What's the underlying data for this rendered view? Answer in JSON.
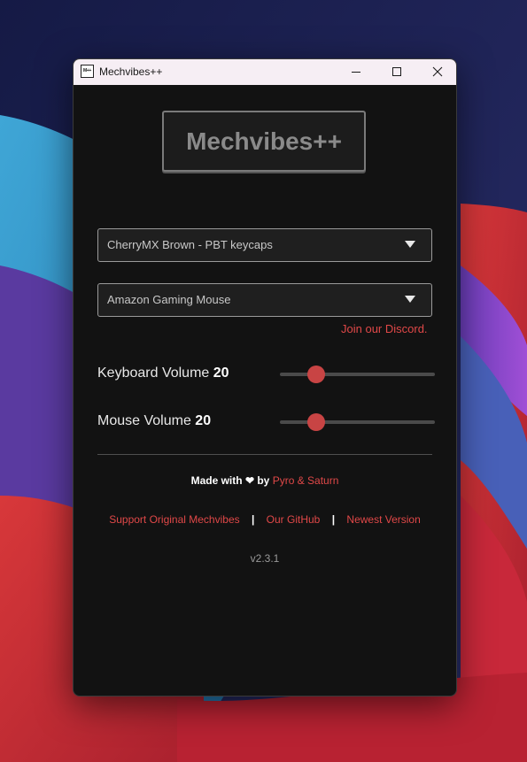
{
  "window": {
    "title": "Mechvibes++",
    "icon_text": "M++"
  },
  "logo": {
    "text": "Mechvibes++"
  },
  "keyboard_select": {
    "selected": "CherryMX Brown - PBT keycaps"
  },
  "mouse_select": {
    "selected": "Amazon Gaming Mouse"
  },
  "discord_link": "Join our Discord.",
  "keyboard_volume": {
    "label": "Keyboard Volume",
    "value": "20",
    "level": 0.2
  },
  "mouse_volume": {
    "label": "Mouse Volume",
    "value": "20",
    "level": 0.2
  },
  "footer": {
    "made_with": "Made with",
    "heart": "❤",
    "by": "by",
    "authors": "Pyro & Saturn",
    "links": [
      "Support Original Mechvibes",
      "Our GitHub",
      "Newest Version"
    ],
    "separator": "|",
    "version": "v2.3.1"
  },
  "colors": {
    "accent": "#e04848",
    "slider_thumb": "#c84444",
    "window_bg": "#121212",
    "titlebar_bg": "#f6eef4"
  },
  "icons": [
    "minimize-icon",
    "maximize-icon",
    "close-icon",
    "dropdown-arrow-icon",
    "heart-icon"
  ]
}
